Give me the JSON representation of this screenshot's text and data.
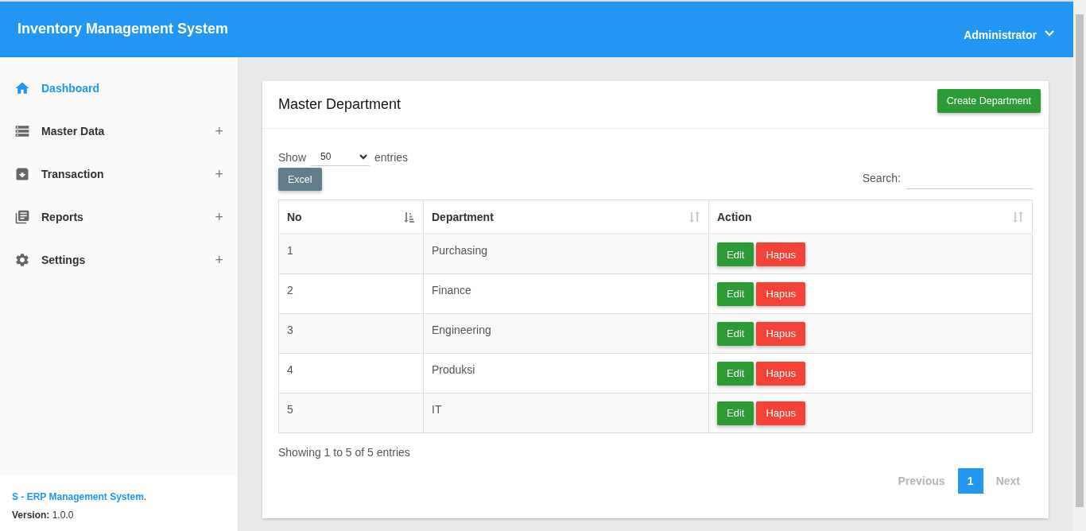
{
  "header": {
    "title": "Inventory Management System",
    "user": "Administrator"
  },
  "sidebar": {
    "items": [
      {
        "label": "Dashboard",
        "selected": true
      },
      {
        "label": "Master Data",
        "selected": false,
        "toggle": "+"
      },
      {
        "label": "Transaction",
        "selected": false,
        "toggle": "+"
      },
      {
        "label": "Reports",
        "selected": false,
        "toggle": "+"
      },
      {
        "label": "Settings",
        "selected": false,
        "toggle": "+"
      }
    ],
    "footer": {
      "link": "S - ERP Management System",
      "suffix": ".",
      "version": "**Version:** 1.0.0"
    }
  },
  "card": {
    "title": "Master Department",
    "create_button": "Create Department",
    "length": {
      "before": "Show",
      "value": "50",
      "after": "entries"
    },
    "excel_button": "Excel",
    "search_label": "Search:",
    "table": {
      "columns": [
        {
          "label": "No",
          "sorted": true
        },
        {
          "label": "Department",
          "sorted": false
        },
        {
          "label": "Action",
          "sorted": false
        }
      ],
      "rows": [
        {
          "no": "1",
          "department": "Purchasing",
          "edit": "Edit",
          "delete": "Hapus"
        },
        {
          "no": "2",
          "department": "Finance",
          "edit": "Edit",
          "delete": "Hapus"
        },
        {
          "no": "3",
          "department": "Engineering",
          "edit": "Edit",
          "delete": "Hapus"
        },
        {
          "no": "4",
          "department": "Produksi",
          "edit": "Edit",
          "delete": "Hapus"
        },
        {
          "no": "5",
          "department": "IT",
          "edit": "Edit",
          "delete": "Hapus"
        }
      ]
    },
    "info": "Showing 1 to 5 of 5 entries",
    "pagination": [
      {
        "label": "Previous",
        "selected": false,
        "disabled": true
      },
      {
        "label": "1",
        "selected": true,
        "disabled": false
      },
      {
        "label": "Next",
        "selected": false,
        "disabled": true
      }
    ]
  }
}
